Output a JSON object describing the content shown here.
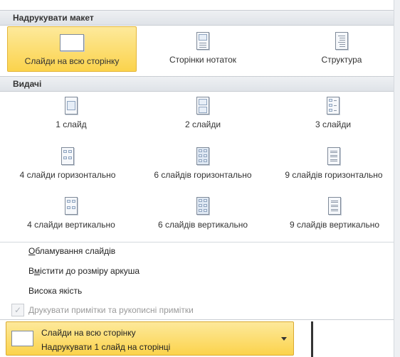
{
  "print_layout": {
    "header": "Надрукувати макет",
    "items": [
      {
        "label": "Слайди на всю сторінку",
        "icon": "full-page-slide-icon",
        "selected": true
      },
      {
        "label": "Сторінки нотаток",
        "icon": "notes-page-icon",
        "selected": false
      },
      {
        "label": "Структура",
        "icon": "outline-icon",
        "selected": false
      }
    ]
  },
  "handouts": {
    "header": "Видачі",
    "items": [
      {
        "label": "1 слайд",
        "icon": "handout-1-slide-icon"
      },
      {
        "label": "2 слайди",
        "icon": "handout-2-slides-icon"
      },
      {
        "label": "3 слайди",
        "icon": "handout-3-slides-icon"
      },
      {
        "label": "4 слайди горизонтально",
        "icon": "handout-4-horizontal-icon"
      },
      {
        "label": "6 слайдів горизонтально",
        "icon": "handout-6-horizontal-icon"
      },
      {
        "label": "9 слайдів горизонтально",
        "icon": "handout-9-horizontal-icon"
      },
      {
        "label": "4 слайди вертикально",
        "icon": "handout-4-vertical-icon"
      },
      {
        "label": "6 слайдів вертикально",
        "icon": "handout-6-vertical-icon"
      },
      {
        "label": "9 слайдів вертикально",
        "icon": "handout-9-vertical-icon"
      }
    ]
  },
  "options": {
    "frame_slides_underline": "О",
    "frame_slides_rest": "бламування слайдів",
    "scale_to_fit_pre": "В",
    "scale_to_fit_underline": "м",
    "scale_to_fit_rest": "істити до розміру аркуша",
    "high_quality": "Висока якість",
    "print_comments": "Друкувати примітки та рукописні примітки",
    "print_comments_enabled": false
  },
  "dropdown": {
    "title": "Слайди на всю сторінку",
    "subtitle": "Надрукувати 1 слайд на сторінці"
  },
  "colors": {
    "selected_fill": "#fbd34c",
    "selected_border": "#e3b53a",
    "header_fill": "#dfe3e8"
  }
}
